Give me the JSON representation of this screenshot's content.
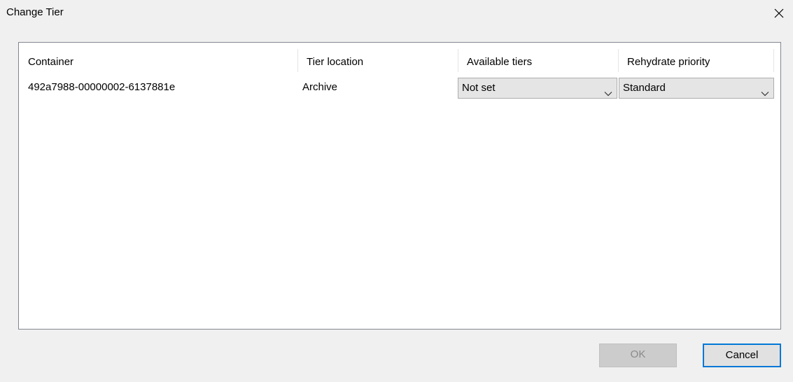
{
  "dialog": {
    "title": "Change Tier",
    "close_label": "×"
  },
  "table": {
    "columns": [
      "Container",
      "Tier location",
      "Available tiers",
      "Rehydrate priority"
    ],
    "rows": [
      {
        "container": "492a7988-00000002-6137881e",
        "tier_location": "Archive",
        "available_tiers": "Not set",
        "rehydrate_priority": "Standard"
      }
    ]
  },
  "buttons": {
    "ok_label": "OK",
    "ok_enabled": false,
    "cancel_label": "Cancel"
  },
  "icons": {
    "close": "close-icon",
    "dropdown": "chevron-down-icon"
  },
  "colors": {
    "focus_border": "#0078d7",
    "disabled_button": "#cccccc",
    "dialog_background": "#f0f0f0"
  }
}
